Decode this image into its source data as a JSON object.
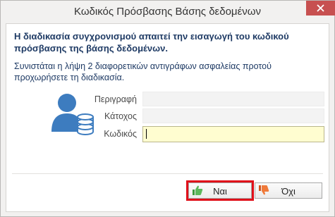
{
  "window": {
    "title": "Κωδικός Πρόσβασης Βάσης δεδομένων"
  },
  "message": {
    "headline": "Η διαδικασία συγχρονισμού απαιτεί την εισαγωγή του κωδικού πρόσβασης της βάσης δεδομένων.",
    "subline": "Συνιστάται η λήψη 2 διαφορετικών αντιγράφων ασφαλείας προτού προχωρήσετε τη διαδικασία."
  },
  "fields": {
    "description": {
      "label": "Περιγραφή",
      "value": ""
    },
    "owner": {
      "label": "Κάτοχος",
      "value": ""
    },
    "password": {
      "label": "Κωδικός",
      "value": ""
    }
  },
  "buttons": {
    "yes_label": "Ναι",
    "no_label": "Όχι"
  },
  "icons": {
    "close": "close-icon",
    "user": "database-user-icon",
    "yes": "thumbs-up-icon",
    "no": "thumbs-down-icon"
  },
  "colors": {
    "close_button": "#c75050",
    "text_blue": "#1e3a64",
    "icon_blue": "#3d7cbf",
    "active_field": "#fffdd0",
    "highlight": "#e0101a"
  }
}
